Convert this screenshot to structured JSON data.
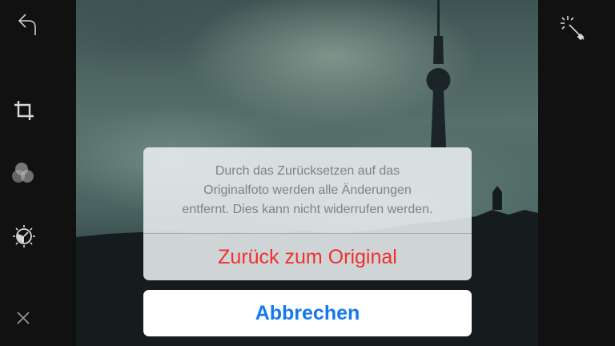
{
  "toolbar_left": {
    "items": [
      {
        "icon": "undo-icon"
      },
      {
        "icon": "crop-icon"
      },
      {
        "icon": "filters-icon"
      },
      {
        "icon": "adjust-dial-icon"
      },
      {
        "icon": "close-icon"
      }
    ]
  },
  "toolbar_right": {
    "items": [
      {
        "icon": "magic-wand-icon"
      }
    ]
  },
  "reset_dialog": {
    "message": "Durch das Zurücksetzen auf das\nOriginalfoto werden alle Änderungen\nentfernt. Dies kann nicht widerrufen werden.",
    "revert_label": "Zurück zum Original",
    "cancel_label": "Abbrechen"
  },
  "colors": {
    "destructive": "#f2302c",
    "accent": "#1478f0",
    "icon": "#d8d8d8"
  }
}
